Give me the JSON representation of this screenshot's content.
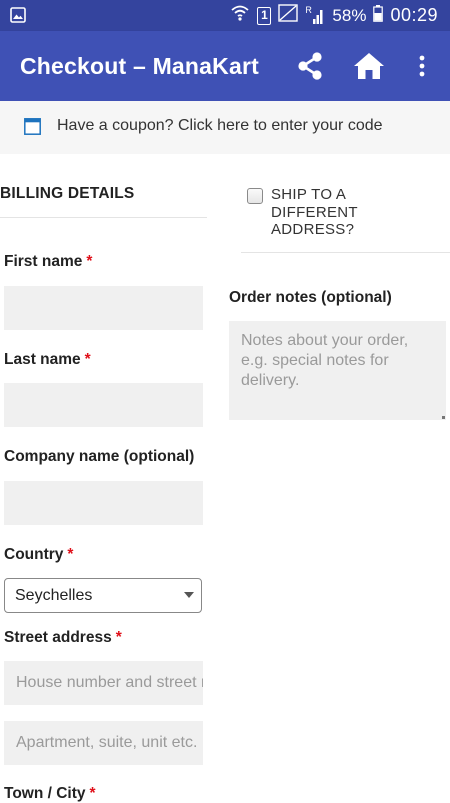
{
  "status_bar": {
    "sim_badge": "1",
    "roaming": "R",
    "battery": "58%",
    "time": "00:29"
  },
  "app_bar": {
    "title": "Checkout – ManaKart",
    "icons": [
      "share-icon",
      "home-icon",
      "overflow-menu-icon"
    ]
  },
  "coupon": {
    "text": "Have a coupon? Click here to enter your code"
  },
  "billing": {
    "heading": "BILLING DETAILS",
    "required_mark": "*",
    "first_name": {
      "label": "First name",
      "value": ""
    },
    "last_name": {
      "label": "Last name",
      "value": ""
    },
    "company": {
      "label": "Company name (optional)",
      "value": ""
    },
    "country": {
      "label": "Country",
      "value": "Seychelles"
    },
    "street": {
      "label": "Street address",
      "placeholder_1": "House number and street name",
      "placeholder_2": "Apartment, suite, unit etc."
    },
    "town": {
      "label": "Town / City"
    }
  },
  "shipping": {
    "ship_label": "SHIP TO A DIFFERENT ADDRESS?",
    "checked": false
  },
  "order_notes": {
    "label": "Order notes (optional)",
    "placeholder": "Notes about your order, e.g. special notes for delivery."
  },
  "colors": {
    "status_bar": "#34449e",
    "app_bar": "#3f51b5",
    "required": "#e0101a"
  }
}
